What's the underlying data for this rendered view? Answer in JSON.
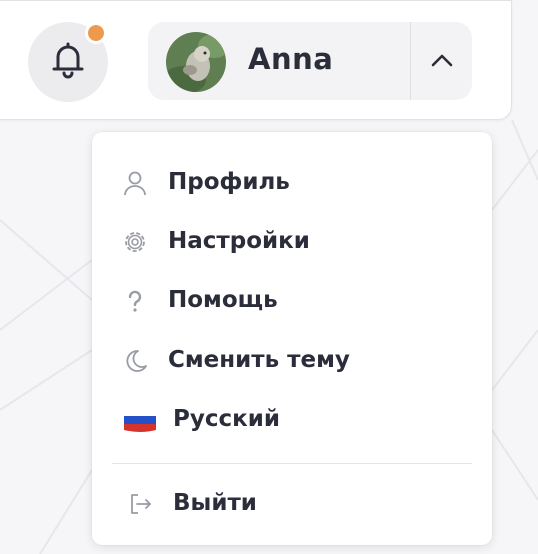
{
  "header": {
    "notifications": {
      "icon": "bell-icon",
      "badge_color": "#ee9a4d"
    },
    "user": {
      "name": "Anna",
      "avatar_icon": "avatar",
      "toggle_icon": "chevron-up-icon"
    }
  },
  "dropdown": {
    "items": [
      {
        "label": "Профиль",
        "icon": "user-icon"
      },
      {
        "label": "Настройки",
        "icon": "gear-icon"
      },
      {
        "label": "Помощь",
        "icon": "question-icon"
      },
      {
        "label": "Сменить тему",
        "icon": "moon-icon"
      },
      {
        "label": "Русский",
        "icon": "russia-flag-icon"
      }
    ],
    "logout": {
      "label": "Выйти",
      "icon": "logout-icon"
    }
  },
  "colors": {
    "text": "#2b2d3a",
    "icon": "#9a9ca5",
    "badge": "#ee9a4d",
    "background": "#f6f6f8"
  }
}
